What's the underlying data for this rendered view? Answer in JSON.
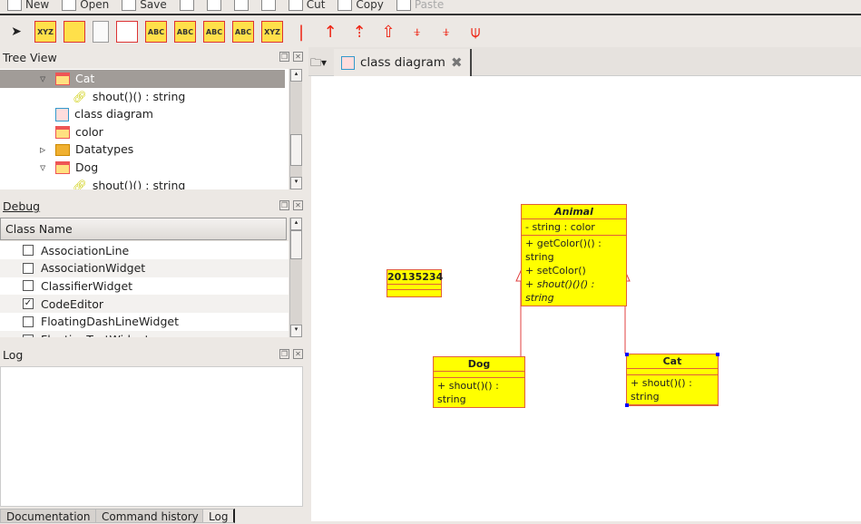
{
  "toolbar_main": {
    "items": [
      {
        "label": "New",
        "icon": "new-file-icon"
      },
      {
        "label": "Open",
        "icon": "open-icon"
      },
      {
        "label": "Save",
        "icon": "save-icon"
      },
      {
        "label": "",
        "icon": "print-icon"
      },
      {
        "label": "",
        "icon": "print-preview-icon"
      },
      {
        "label": "",
        "icon": "undo-icon"
      },
      {
        "label": "",
        "icon": "redo-icon"
      },
      {
        "label": "Cut",
        "icon": "cut-icon"
      },
      {
        "label": "Copy",
        "icon": "copy-icon"
      },
      {
        "label": "Paste",
        "icon": "paste-icon"
      }
    ]
  },
  "toolbar_diagram": {
    "items": [
      {
        "name": "select-arrow-icon",
        "glyph": "➤"
      },
      {
        "name": "package-icon",
        "glyph": "XYZ"
      },
      {
        "name": "component-icon",
        "glyph": ""
      },
      {
        "name": "note-icon",
        "glyph": ""
      },
      {
        "name": "box-icon",
        "glyph": ""
      },
      {
        "name": "class-icon",
        "glyph": "ABC"
      },
      {
        "name": "interface-icon",
        "glyph": "ABC"
      },
      {
        "name": "datatype-icon",
        "glyph": "ABC"
      },
      {
        "name": "enum-icon",
        "glyph": "ABC"
      },
      {
        "name": "folder-package-icon",
        "glyph": "XYZ"
      },
      {
        "name": "association-icon",
        "glyph": "|"
      },
      {
        "name": "directed-association-icon",
        "glyph": "↑"
      },
      {
        "name": "dependency-icon",
        "glyph": "⇡"
      },
      {
        "name": "generalization-icon",
        "glyph": "⇧"
      },
      {
        "name": "aggregation-icon",
        "glyph": "⍖"
      },
      {
        "name": "composition-icon",
        "glyph": "⍖"
      },
      {
        "name": "containment-icon",
        "glyph": "⍦"
      }
    ]
  },
  "tree": {
    "title": "Tree View",
    "items": [
      {
        "label": "Cat",
        "expanded": true,
        "selected": true,
        "indent": 1,
        "icon": "class-icon"
      },
      {
        "label": "shout()() : string",
        "indent": 2,
        "icon": "operation-icon"
      },
      {
        "label": "class diagram",
        "indent": 1,
        "icon": "diagram-icon"
      },
      {
        "label": "color",
        "indent": 1,
        "icon": "class-icon"
      },
      {
        "label": "Datatypes",
        "indent": 1,
        "icon": "folder-icon",
        "collapsed": true
      },
      {
        "label": "Dog",
        "indent": 1,
        "icon": "class-icon",
        "expanded": true
      },
      {
        "label": "shout()() : string",
        "indent": 2,
        "icon": "operation-icon"
      }
    ]
  },
  "debug": {
    "title": "Debug",
    "column": "Class Name",
    "rows": [
      {
        "label": "AssociationLine",
        "checked": false
      },
      {
        "label": "AssociationWidget",
        "checked": false
      },
      {
        "label": "ClassifierWidget",
        "checked": false
      },
      {
        "label": "CodeEditor",
        "checked": true
      },
      {
        "label": "FloatingDashLineWidget",
        "checked": false
      },
      {
        "label": "FloatingTextWidget",
        "checked": false
      }
    ]
  },
  "log": {
    "title": "Log"
  },
  "bottom_tabs": [
    "Documentation",
    "Command history",
    "Log"
  ],
  "editor": {
    "tab": "class diagram"
  },
  "diagram": {
    "animal": {
      "name": "Animal",
      "attributes": [
        "- string : color"
      ],
      "operations": [
        "+ getColor()() : string",
        "+ setColor()",
        "+ shout()()() : string"
      ]
    },
    "dog": {
      "name": "Dog",
      "operations": [
        "+ shout()() : string"
      ]
    },
    "cat": {
      "name": "Cat",
      "operations": [
        "+ shout()() : string"
      ]
    },
    "obj": {
      "name": "20135234"
    }
  },
  "colors": {
    "class_fill": "#ffff00",
    "class_border": "#e0603a",
    "selection": "#a19c98"
  }
}
